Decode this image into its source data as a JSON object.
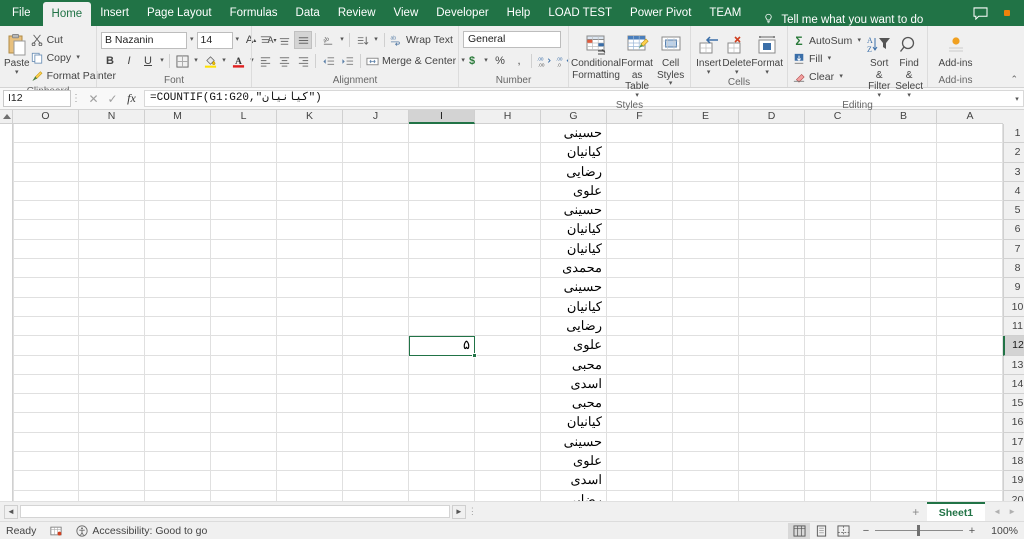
{
  "app": {
    "tabs": [
      {
        "label": "File",
        "active": false,
        "file": true
      },
      {
        "label": "Home",
        "active": true
      },
      {
        "label": "Insert",
        "active": false
      },
      {
        "label": "Page Layout",
        "active": false
      },
      {
        "label": "Formulas",
        "active": false
      },
      {
        "label": "Data",
        "active": false
      },
      {
        "label": "Review",
        "active": false
      },
      {
        "label": "View",
        "active": false
      },
      {
        "label": "Developer",
        "active": false
      },
      {
        "label": "Help",
        "active": false
      },
      {
        "label": "LOAD TEST",
        "active": false
      },
      {
        "label": "Power Pivot",
        "active": false
      },
      {
        "label": "TEAM",
        "active": false
      }
    ],
    "tellme": "Tell me what you want to do",
    "accent": "#217346"
  },
  "ribbon": {
    "clipboard": {
      "label": "Clipboard",
      "paste": "Paste",
      "cut": "Cut",
      "copy": "Copy",
      "format_painter": "Format Painter"
    },
    "font": {
      "label": "Font",
      "font_name": "B Nazanin",
      "font_size": "14",
      "bold": "B",
      "italic": "I",
      "underline": "U"
    },
    "alignment": {
      "label": "Alignment",
      "wrap_text": "Wrap Text",
      "merge_center": "Merge & Center"
    },
    "number": {
      "label": "Number",
      "format": "General",
      "currency": "$",
      "percent": "%",
      "comma": ","
    },
    "styles": {
      "label": "Styles",
      "conditional_formatting": "Conditional\nFormatting",
      "conditional_formatting_l1": "Conditional",
      "conditional_formatting_l2": "Formatting",
      "format_as_table_l1": "Format as",
      "format_as_table_l2": "Table",
      "cell_styles_l1": "Cell",
      "cell_styles_l2": "Styles"
    },
    "cells": {
      "label": "Cells",
      "insert": "Insert",
      "delete": "Delete",
      "format": "Format"
    },
    "editing": {
      "label": "Editing",
      "autosum": "AutoSum",
      "fill": "Fill",
      "clear": "Clear",
      "sort_filter_l1": "Sort &",
      "sort_filter_l2": "Filter",
      "find_select_l1": "Find &",
      "find_select_l2": "Select"
    },
    "addins": {
      "label": "Add-ins",
      "addins": "Add-ins"
    }
  },
  "formula_bar": {
    "name_box": "I12",
    "formula": "=COUNTIF(G1:G20,\"کیانیان\")",
    "cancel_icon": "✕",
    "enter_icon": "✓",
    "fx_icon": "fx"
  },
  "grid": {
    "columns": [
      "O",
      "N",
      "M",
      "L",
      "K",
      "J",
      "I",
      "H",
      "G",
      "F",
      "E",
      "D",
      "C",
      "B",
      "A"
    ],
    "selected_column": "I",
    "selected_row": 12,
    "rows": [
      {
        "num": "1",
        "G": "حسینی",
        "I": ""
      },
      {
        "num": "2",
        "G": "کیانیان",
        "I": ""
      },
      {
        "num": "3",
        "G": "رضایی",
        "I": ""
      },
      {
        "num": "4",
        "G": "علوی",
        "I": ""
      },
      {
        "num": "5",
        "G": "حسینی",
        "I": ""
      },
      {
        "num": "6",
        "G": "کیانیان",
        "I": ""
      },
      {
        "num": "7",
        "G": "کیانیان",
        "I": ""
      },
      {
        "num": "8",
        "G": "محمدی",
        "I": ""
      },
      {
        "num": "9",
        "G": "حسینی",
        "I": ""
      },
      {
        "num": "10",
        "G": "کیانیان",
        "I": ""
      },
      {
        "num": "11",
        "G": "رضایی",
        "I": ""
      },
      {
        "num": "12",
        "G": "علوی",
        "I": "۵"
      },
      {
        "num": "13",
        "G": "محبی",
        "I": ""
      },
      {
        "num": "14",
        "G": "اسدی",
        "I": ""
      },
      {
        "num": "15",
        "G": "محبی",
        "I": ""
      },
      {
        "num": "16",
        "G": "کیانیان",
        "I": ""
      },
      {
        "num": "17",
        "G": "حسینی",
        "I": ""
      },
      {
        "num": "18",
        "G": "علوی",
        "I": ""
      },
      {
        "num": "19",
        "G": "اسدی",
        "I": ""
      },
      {
        "num": "20",
        "G": "رضایی",
        "I": ""
      }
    ]
  },
  "sheet_tabs": {
    "active": "Sheet1",
    "add_label": "+"
  },
  "status_bar": {
    "ready": "Ready",
    "accessibility": "Accessibility: Good to go",
    "zoom": "100%",
    "zoom_minus": "−",
    "zoom_plus": "+"
  }
}
